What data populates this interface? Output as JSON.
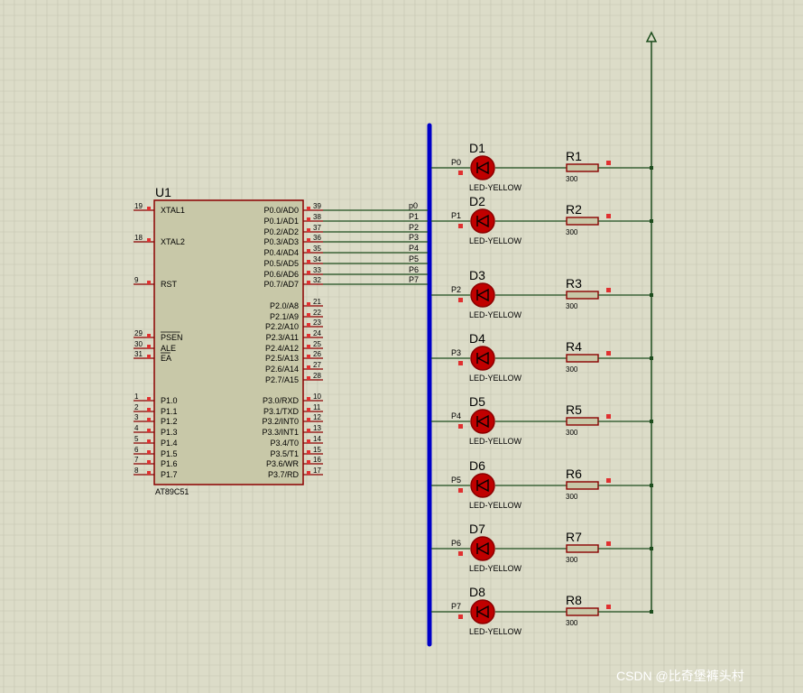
{
  "schematic": {
    "mcu": {
      "ref": "U1",
      "part": "AT89C51",
      "left_pins": [
        {
          "num": "19",
          "name": "XTAL1",
          "overline": false
        },
        {
          "num": "18",
          "name": "XTAL2",
          "overline": false
        },
        {
          "num": "9",
          "name": "RST",
          "overline": false
        },
        {
          "num": "29",
          "name": "PSEN",
          "overline": true
        },
        {
          "num": "30",
          "name": "ALE",
          "overline": false
        },
        {
          "num": "31",
          "name": "EA",
          "overline": true
        },
        {
          "num": "1",
          "name": "P1.0",
          "overline": false
        },
        {
          "num": "2",
          "name": "P1.1",
          "overline": false
        },
        {
          "num": "3",
          "name": "P1.2",
          "overline": false
        },
        {
          "num": "4",
          "name": "P1.3",
          "overline": false
        },
        {
          "num": "5",
          "name": "P1.4",
          "overline": false
        },
        {
          "num": "6",
          "name": "P1.5",
          "overline": false
        },
        {
          "num": "7",
          "name": "P1.6",
          "overline": false
        },
        {
          "num": "8",
          "name": "P1.7",
          "overline": false
        }
      ],
      "right_pins": [
        {
          "num": "39",
          "name": "P0.0/AD0"
        },
        {
          "num": "38",
          "name": "P0.1/AD1"
        },
        {
          "num": "37",
          "name": "P0.2/AD2"
        },
        {
          "num": "36",
          "name": "P0.3/AD3"
        },
        {
          "num": "35",
          "name": "P0.4/AD4"
        },
        {
          "num": "34",
          "name": "P0.5/AD5"
        },
        {
          "num": "33",
          "name": "P0.6/AD6"
        },
        {
          "num": "32",
          "name": "P0.7/AD7"
        },
        {
          "num": "21",
          "name": "P2.0/A8"
        },
        {
          "num": "22",
          "name": "P2.1/A9"
        },
        {
          "num": "23",
          "name": "P2.2/A10"
        },
        {
          "num": "24",
          "name": "P2.3/A11"
        },
        {
          "num": "25",
          "name": "P2.4/A12"
        },
        {
          "num": "26",
          "name": "P2.5/A13"
        },
        {
          "num": "27",
          "name": "P2.6/A14"
        },
        {
          "num": "28",
          "name": "P2.7/A15"
        },
        {
          "num": "10",
          "name": "P3.0/RXD"
        },
        {
          "num": "11",
          "name": "P3.1/TXD"
        },
        {
          "num": "12",
          "name": "P3.2/INT0"
        },
        {
          "num": "13",
          "name": "P3.3/INT1"
        },
        {
          "num": "14",
          "name": "P3.4/T0"
        },
        {
          "num": "15",
          "name": "P3.5/T1"
        },
        {
          "num": "16",
          "name": "P3.6/WR"
        },
        {
          "num": "17",
          "name": "P3.7/RD"
        }
      ]
    },
    "bus_labels": [
      "p0",
      "P1",
      "P2",
      "P3",
      "P4",
      "P5",
      "P6",
      "P7"
    ],
    "led_rows": [
      {
        "net": "P0",
        "diode": "D1",
        "diode_value": "LED-YELLOW",
        "resistor": "R1",
        "resistor_value": "300"
      },
      {
        "net": "P1",
        "diode": "D2",
        "diode_value": "LED-YELLOW",
        "resistor": "R2",
        "resistor_value": "300"
      },
      {
        "net": "P2",
        "diode": "D3",
        "diode_value": "LED-YELLOW",
        "resistor": "R3",
        "resistor_value": "300"
      },
      {
        "net": "P3",
        "diode": "D4",
        "diode_value": "LED-YELLOW",
        "resistor": "R4",
        "resistor_value": "300"
      },
      {
        "net": "P4",
        "diode": "D5",
        "diode_value": "LED-YELLOW",
        "resistor": "R5",
        "resistor_value": "300"
      },
      {
        "net": "P5",
        "diode": "D6",
        "diode_value": "LED-YELLOW",
        "resistor": "R6",
        "resistor_value": "300"
      },
      {
        "net": "P6",
        "diode": "D7",
        "diode_value": "LED-YELLOW",
        "resistor": "R7",
        "resistor_value": "300"
      },
      {
        "net": "P7",
        "diode": "D8",
        "diode_value": "LED-YELLOW",
        "resistor": "R8",
        "resistor_value": "300"
      }
    ],
    "watermark": "CSDN @比奇堡裤头村",
    "colors": {
      "background": "#dcdcc8",
      "grid": "#c4c4b0",
      "wire": "#1d4d1d",
      "bus": "#0000c8",
      "component": "#8b0000",
      "chip_fill": "#c8c8a8",
      "pin_marker": "#e03030",
      "power": "#1d4d1d"
    }
  }
}
